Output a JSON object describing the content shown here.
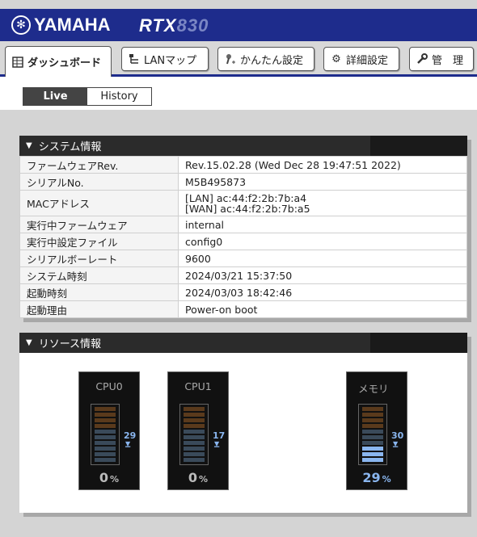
{
  "header": {
    "brand": "YAMAHA",
    "model_prefix": "RTX",
    "model_suffix": "830"
  },
  "tabs": [
    {
      "label": "ダッシュボード",
      "icon": "dashboard-icon"
    },
    {
      "label": "LANマップ",
      "icon": "lan-map-icon"
    },
    {
      "label": "かんたん設定",
      "icon": "wizard-icon"
    },
    {
      "label": "詳細設定",
      "icon": "gear-icon"
    },
    {
      "label": "管　理",
      "icon": "wrench-icon"
    }
  ],
  "view_toggle": {
    "live": "Live",
    "history": "History",
    "selected": "Live"
  },
  "system_info": {
    "title": "システム情報",
    "rows": [
      {
        "key": "ファームウェアRev.",
        "value": "Rev.15.02.28 (Wed Dec 28 19:47:51 2022)"
      },
      {
        "key": "シリアルNo.",
        "value": "M5B495873"
      },
      {
        "key": "MACアドレス",
        "value": "[LAN] ac:44:f2:2b:7b:a4",
        "value2": "[WAN] ac:44:f2:2b:7b:a5"
      },
      {
        "key": "実行中ファームウェア",
        "value": "internal"
      },
      {
        "key": "実行中設定ファイル",
        "value": "config0"
      },
      {
        "key": "シリアルボーレート",
        "value": "9600"
      },
      {
        "key": "システム時刻",
        "value": "2024/03/21 15:37:50"
      },
      {
        "key": "起動時刻",
        "value": "2024/03/03 18:42:46"
      },
      {
        "key": "起動理由",
        "value": "Power-on boot"
      }
    ]
  },
  "resource_info": {
    "title": "リソース情報",
    "meters": [
      {
        "label": "CPU0",
        "value": 0,
        "peak": 29,
        "unit": "%"
      },
      {
        "label": "CPU1",
        "value": 0,
        "peak": 17,
        "unit": "%"
      },
      {
        "label": "メモリ",
        "value": 29,
        "peak": 30,
        "unit": "%"
      }
    ]
  },
  "colors": {
    "header_blue": "#1e2c8c",
    "panel_header": "#2b2b2b",
    "meter_accent": "#8ab6ef"
  }
}
